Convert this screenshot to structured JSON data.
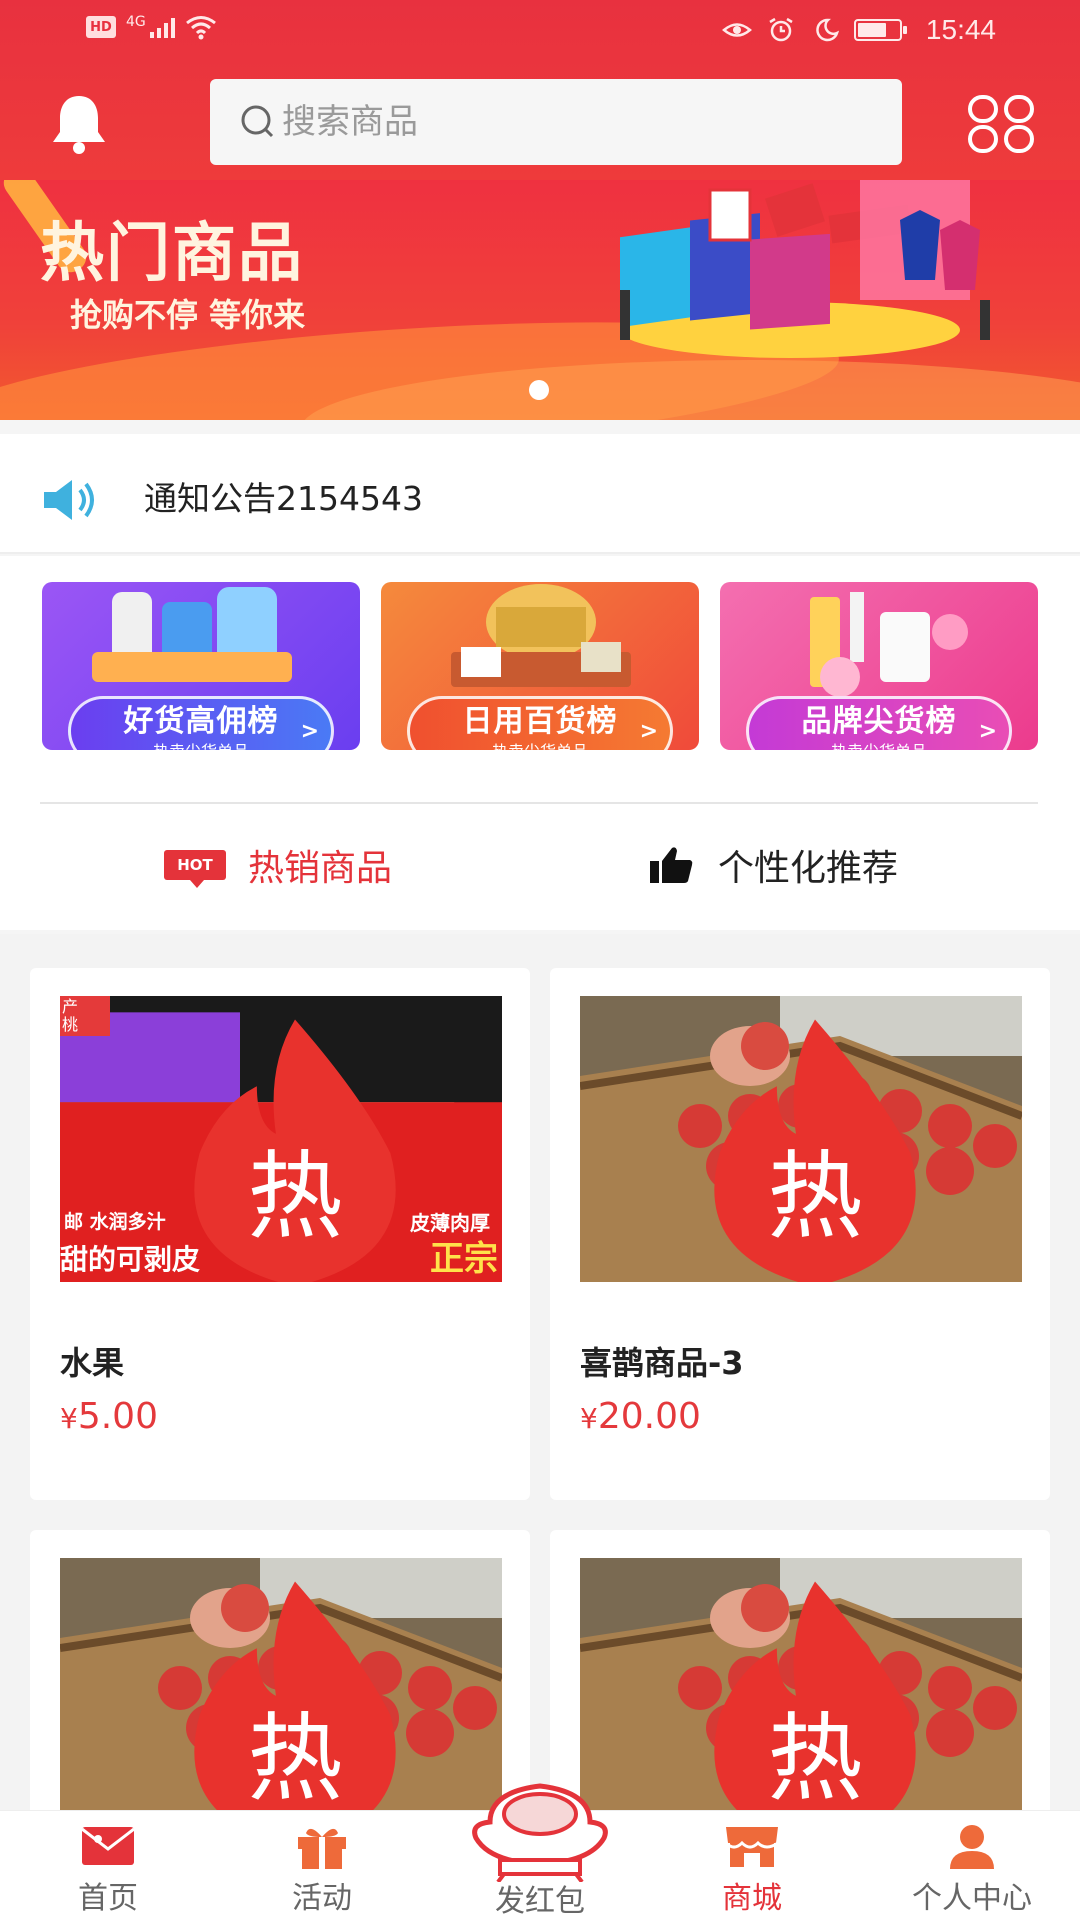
{
  "status_bar": {
    "network_badge": "HD",
    "network_type": "4G",
    "time": "15:44",
    "battery_level_percent": 70
  },
  "header": {
    "search_placeholder": "搜索商品",
    "bell_icon": "bell-icon",
    "grid_icon": "grid-menu-icon"
  },
  "banner": {
    "title": "热门商品",
    "subtitle": "抢购不停 等你来",
    "slide_count": 1,
    "active_slide": 1
  },
  "notice": {
    "text": "通知公告2154543",
    "icon": "speaker-icon"
  },
  "categories": [
    {
      "title": "好货高佣榜",
      "subtitle": "热卖尖货单品",
      "arrow": ">",
      "color": "#8a4df0"
    },
    {
      "title": "日用百货榜",
      "subtitle": "热卖尖货单品",
      "arrow": ">",
      "color": "#f05a3c"
    },
    {
      "title": "品牌尖货榜",
      "subtitle": "热卖尖货单品",
      "arrow": ">",
      "color": "#ec3b8d"
    }
  ],
  "tabs": [
    {
      "badge": "HOT",
      "label": "热销商品",
      "active": true
    },
    {
      "label": "个性化推荐",
      "active": false
    }
  ],
  "hot_label": "热",
  "products": [
    {
      "name": "水果",
      "currency": "¥",
      "price": "5.00",
      "image": "peaches",
      "tag_left": "邮  水润多汁",
      "tag_right": "皮薄肉厚",
      "tag_bottom_left": "甜的可剥皮",
      "tag_bottom_right": "正宗",
      "tag_corner": "产\n桃"
    },
    {
      "name": "喜鹊商品-3",
      "currency": "¥",
      "price": "20.00",
      "image": "apples"
    },
    {
      "name": "",
      "currency": "",
      "price": "",
      "image": "apples"
    },
    {
      "name": "",
      "currency": "",
      "price": "",
      "image": "apples"
    }
  ],
  "bottom_nav": [
    {
      "label": "首页",
      "icon": "home-envelope-icon",
      "active": false
    },
    {
      "label": "活动",
      "icon": "gift-icon",
      "active": false
    },
    {
      "label": "发红包",
      "icon": "red-packet-ingot-icon",
      "active": false
    },
    {
      "label": "商城",
      "icon": "shop-icon",
      "active": true
    },
    {
      "label": "个人中心",
      "icon": "user-icon",
      "active": false
    }
  ],
  "colors": {
    "brand_red": "#e4333a",
    "header_red": "#ee3b3b",
    "price_red": "#e4393c"
  }
}
